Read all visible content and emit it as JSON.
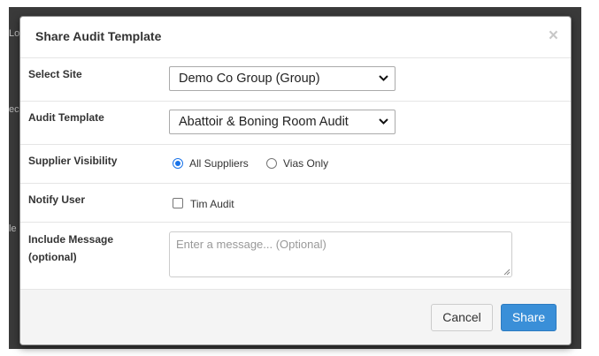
{
  "modal": {
    "title": "Share Audit Template",
    "close_icon": "×"
  },
  "form": {
    "site": {
      "label": "Select Site",
      "value": "Demo Co Group (Group)"
    },
    "template": {
      "label": "Audit Template",
      "value": "Abattoir & Boning Room Audit"
    },
    "supplier_visibility": {
      "label": "Supplier Visibility",
      "options": [
        {
          "label": "All Suppliers",
          "checked": true
        },
        {
          "label": "Vias Only",
          "checked": false
        }
      ]
    },
    "notify_user": {
      "label": "Notify User",
      "options": [
        {
          "label": "Tim Audit",
          "checked": false
        }
      ]
    },
    "message": {
      "label_line1": "Include Message",
      "label_line2": "(optional)",
      "placeholder": "Enter a message... (Optional)"
    }
  },
  "footer": {
    "cancel_label": "Cancel",
    "share_label": "Share"
  },
  "background_fragments": [
    "Lo",
    "ec",
    "le"
  ],
  "colors": {
    "primary": "#3a8fd8",
    "radio_checked": "#1a73e8",
    "backdrop": "#3a3a3a",
    "footer_bg": "#f4f4f4"
  },
  "icons": [
    "close-icon",
    "chevron-down-icon",
    "resize-grip-icon"
  ]
}
